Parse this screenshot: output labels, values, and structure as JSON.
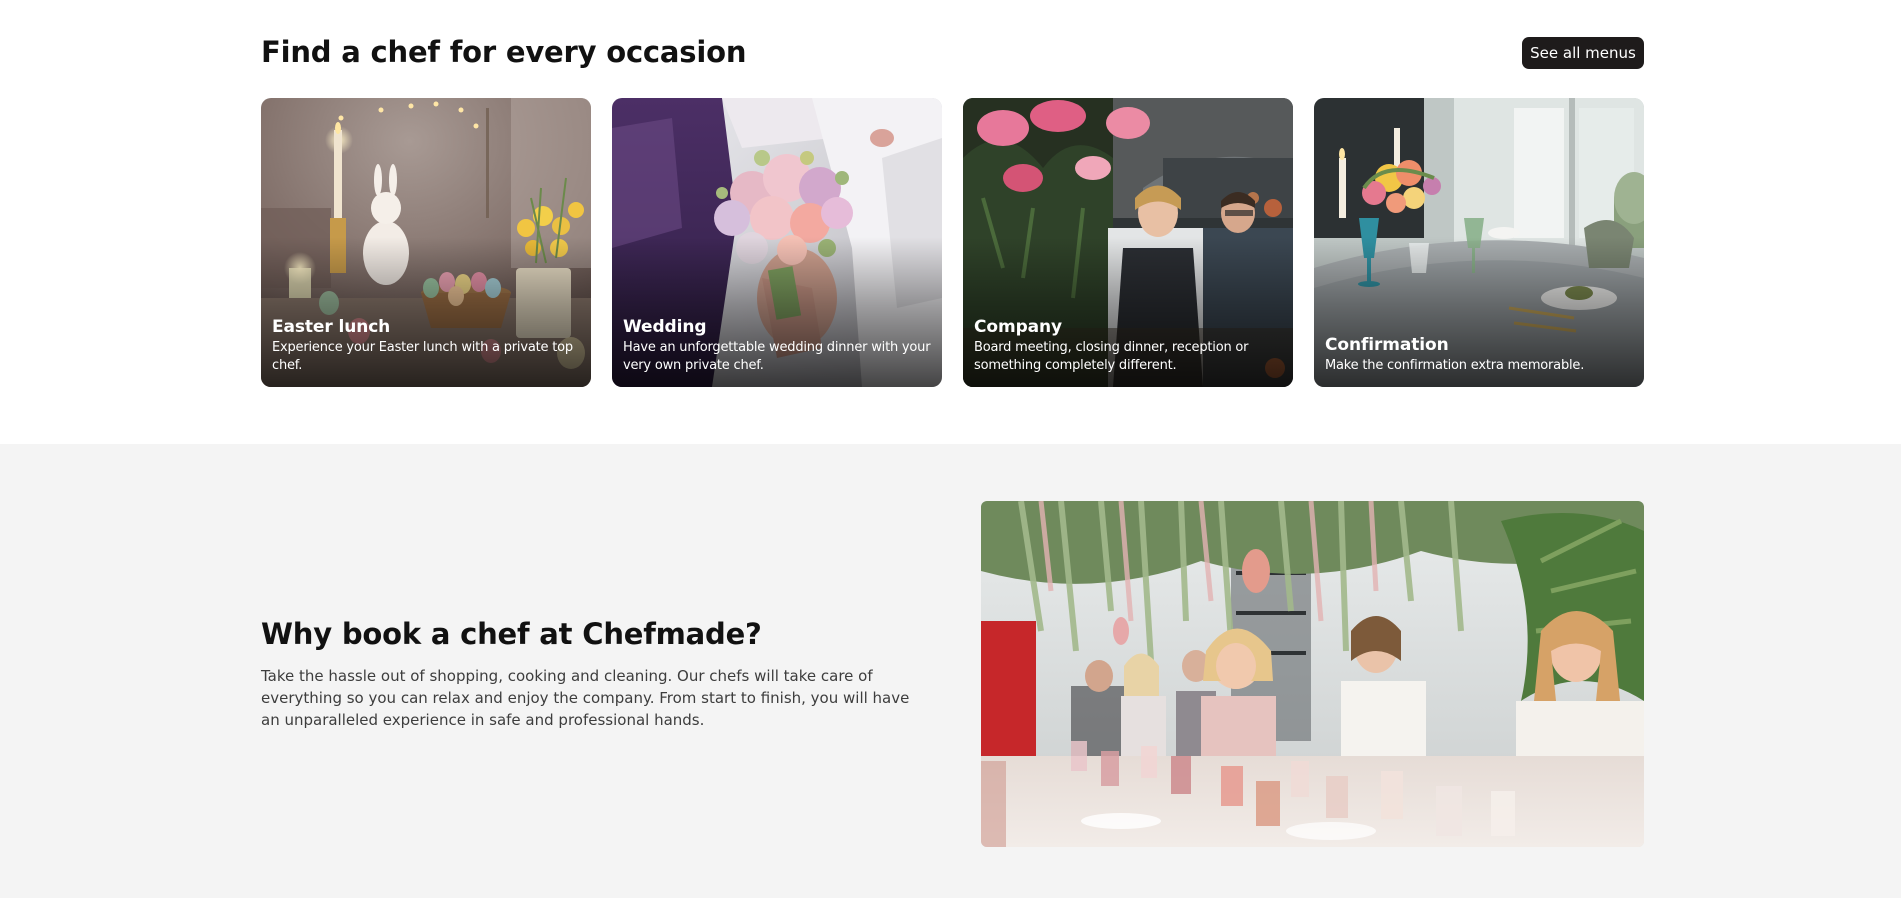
{
  "occasions": {
    "title": "Find a chef for every occasion",
    "see_all_label": "See all menus",
    "cards": [
      {
        "title": "Easter lunch",
        "description": "Experience your Easter lunch with a private top chef.",
        "image": "easter-table-photo"
      },
      {
        "title": "Wedding",
        "description": "Have an unforgettable wedding dinner with your very own private chef.",
        "image": "wedding-bouquet-photo"
      },
      {
        "title": "Company",
        "description": "Board meeting, closing dinner, reception or something completely different.",
        "image": "company-chefs-photo"
      },
      {
        "title": "Confirmation",
        "description": "Make the confirmation extra memorable.",
        "image": "confirmation-table-photo"
      }
    ]
  },
  "why": {
    "title": "Why book a chef at Chefmade?",
    "body": "Take the hassle out of shopping, cooking and cleaning. Our chefs will take care of everything so you can relax and enjoy the company. From start to finish, you will have an unparalleled experience in safe and professional hands.",
    "image": "dinner-party-photo"
  },
  "colors": {
    "button_bg": "#1e1b1b",
    "section_bg": "#f4f4f4",
    "heading_text": "#111111",
    "body_text": "#3d3d3d"
  }
}
